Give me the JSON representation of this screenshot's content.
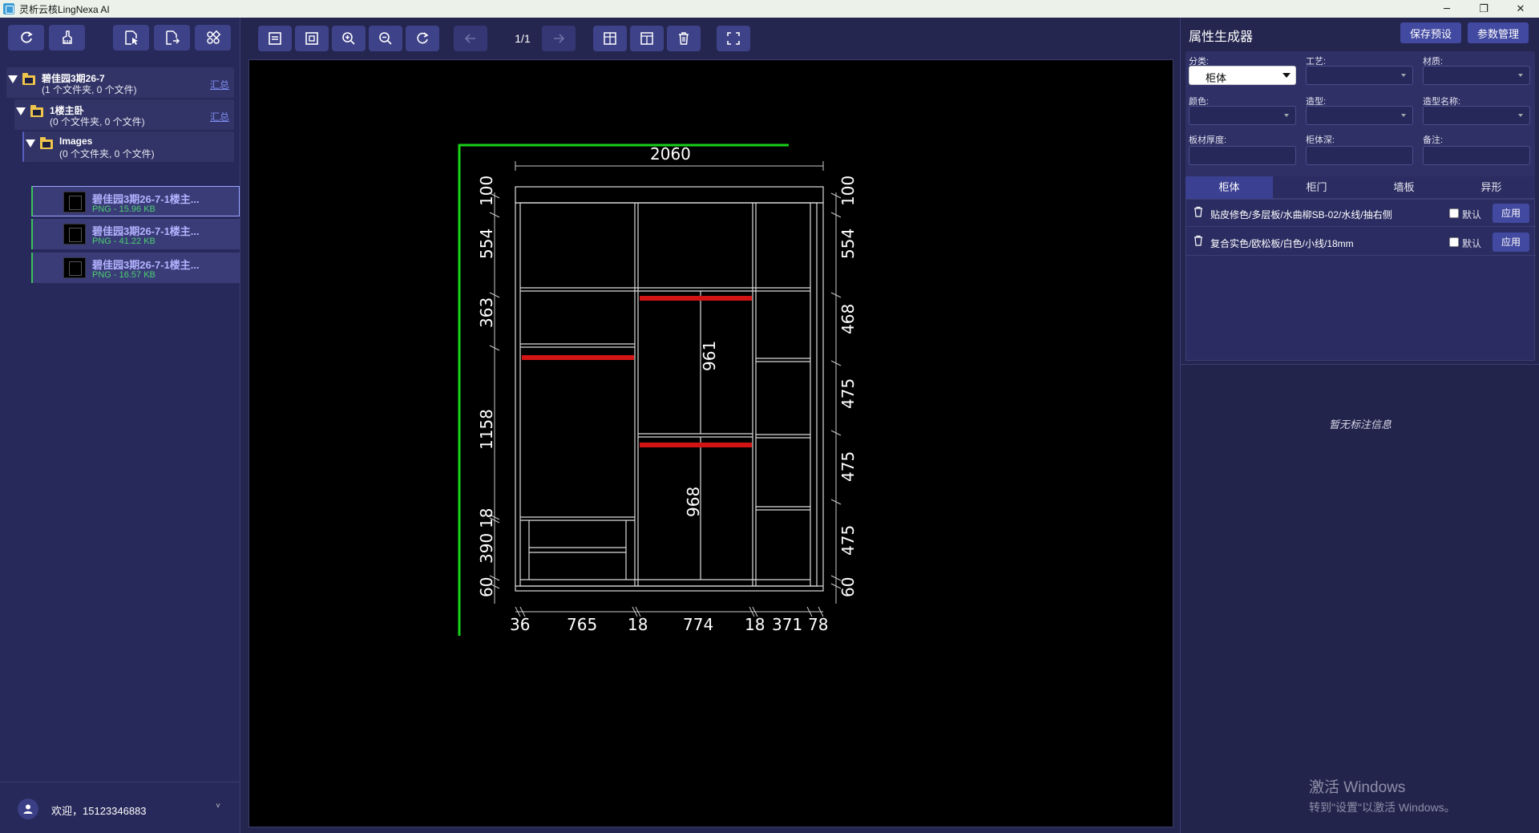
{
  "window": {
    "title": "灵析云核LingNexa AI",
    "minimize": "─",
    "restore": "❐",
    "close": "✕"
  },
  "left_toolbar": {
    "buttons": [
      "refresh-icon",
      "clean-brush-icon",
      "select-file-icon",
      "export-file-icon",
      "apps-icon"
    ]
  },
  "tree": {
    "root": {
      "name": "碧佳园3期26-7",
      "sub": "(1 个文件夹, 0 个文件)",
      "summary": "汇总"
    },
    "level1": {
      "name": "1楼主卧",
      "sub": "(0 个文件夹, 0 个文件)",
      "summary": "汇总"
    },
    "level2": {
      "name": "Images",
      "sub": "(0 个文件夹, 0 个文件)"
    },
    "files": [
      {
        "name": "碧佳园3期26-7-1楼主...",
        "meta": "PNG - 15.96 KB"
      },
      {
        "name": "碧佳园3期26-7-1楼主...",
        "meta": "PNG - 41.22 KB"
      },
      {
        "name": "碧佳园3期26-7-1楼主...",
        "meta": "PNG - 16.57 KB"
      }
    ]
  },
  "user": {
    "welcome": "欢迎，15123346883",
    "caret": "˅"
  },
  "viewer": {
    "page_indicator": "1/1",
    "drawing_dimensions": {
      "top_width": "2060",
      "left_heights": [
        "100",
        "554",
        "363",
        "1158",
        "18",
        "390",
        "60"
      ],
      "right_heights": [
        "100",
        "554",
        "468",
        "475",
        "475",
        "475",
        "60"
      ],
      "bottom_widths": [
        "36",
        "765",
        "18",
        "774",
        "18",
        "371",
        "78"
      ],
      "middle_heights": [
        "961",
        "968"
      ]
    }
  },
  "right_panel": {
    "title": "属性生成器",
    "save_preset": "保存预设",
    "param_manage": "参数管理",
    "fields": {
      "category": {
        "label": "分类:",
        "value": "柜体"
      },
      "craft": {
        "label": "工艺:"
      },
      "material": {
        "label": "材质:"
      },
      "color": {
        "label": "颜色:"
      },
      "shape": {
        "label": "造型:"
      },
      "shape_name": {
        "label": "造型名称:"
      },
      "board_thickness": {
        "label": "板材厚度:"
      },
      "cabinet_depth": {
        "label": "柜体深:"
      },
      "remark": {
        "label": "备注:"
      }
    },
    "tabs": [
      "柜体",
      "柜门",
      "墙板",
      "异形"
    ],
    "presets": [
      {
        "text": "贴皮修色/多层板/水曲柳SB-02/水线/抽右侧",
        "default_label": "默认",
        "apply": "应用"
      },
      {
        "text": "复合实色/欧松板/白色/小线/18mm",
        "default_label": "默认",
        "apply": "应用"
      }
    ],
    "no_annotation": "暂无标注信息",
    "win_activate_1": "激活 Windows",
    "win_activate_2": "转到\"设置\"以激活 Windows。"
  }
}
